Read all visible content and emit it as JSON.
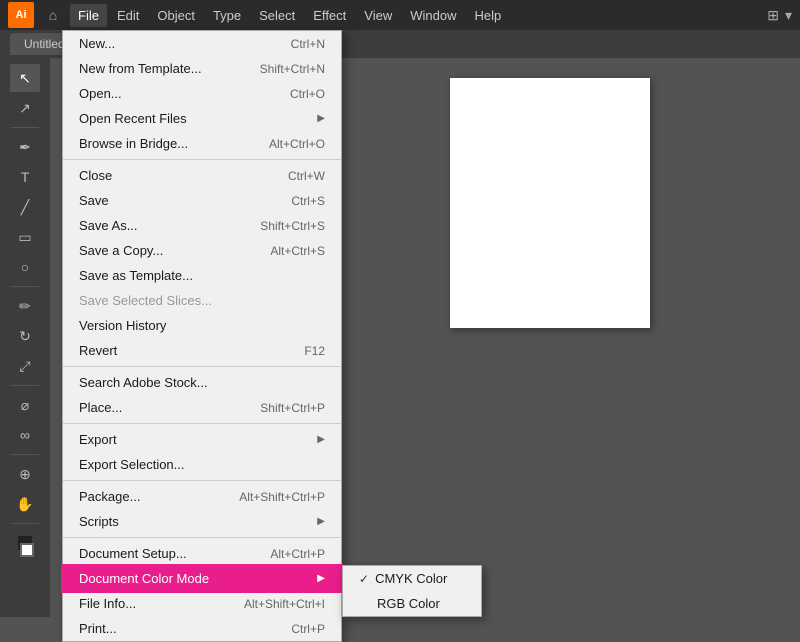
{
  "app": {
    "logo": "Ai",
    "title": "Untitled"
  },
  "menubar": {
    "items": [
      {
        "id": "file",
        "label": "File",
        "active": true
      },
      {
        "id": "edit",
        "label": "Edit"
      },
      {
        "id": "object",
        "label": "Object"
      },
      {
        "id": "type",
        "label": "Type"
      },
      {
        "id": "select",
        "label": "Select"
      },
      {
        "id": "effect",
        "label": "Effect"
      },
      {
        "id": "view",
        "label": "View"
      },
      {
        "id": "window",
        "label": "Window"
      },
      {
        "id": "help",
        "label": "Help"
      }
    ]
  },
  "file_menu": {
    "items": [
      {
        "id": "new",
        "label": "New...",
        "shortcut": "Ctrl+N",
        "disabled": false
      },
      {
        "id": "new-template",
        "label": "New from Template...",
        "shortcut": "Shift+Ctrl+N",
        "disabled": false
      },
      {
        "id": "open",
        "label": "Open...",
        "shortcut": "Ctrl+O",
        "disabled": false
      },
      {
        "id": "open-recent",
        "label": "Open Recent Files",
        "shortcut": "",
        "arrow": true,
        "disabled": false
      },
      {
        "id": "browse-bridge",
        "label": "Browse in Bridge...",
        "shortcut": "Alt+Ctrl+O",
        "disabled": false
      },
      {
        "id": "sep1",
        "type": "separator"
      },
      {
        "id": "close",
        "label": "Close",
        "shortcut": "Ctrl+W",
        "disabled": false
      },
      {
        "id": "save",
        "label": "Save",
        "shortcut": "Ctrl+S",
        "disabled": false
      },
      {
        "id": "save-as",
        "label": "Save As...",
        "shortcut": "Shift+Ctrl+S",
        "disabled": false
      },
      {
        "id": "save-copy",
        "label": "Save a Copy...",
        "shortcut": "Alt+Ctrl+S",
        "disabled": false
      },
      {
        "id": "save-template",
        "label": "Save as Template...",
        "shortcut": "",
        "disabled": false
      },
      {
        "id": "save-selected",
        "label": "Save Selected Slices...",
        "shortcut": "",
        "disabled": true
      },
      {
        "id": "version-history",
        "label": "Version History",
        "shortcut": "",
        "disabled": false
      },
      {
        "id": "revert",
        "label": "Revert",
        "shortcut": "F12",
        "disabled": false
      },
      {
        "id": "sep2",
        "type": "separator"
      },
      {
        "id": "search-stock",
        "label": "Search Adobe Stock...",
        "shortcut": "",
        "disabled": false
      },
      {
        "id": "place",
        "label": "Place...",
        "shortcut": "Shift+Ctrl+P",
        "disabled": false
      },
      {
        "id": "sep3",
        "type": "separator"
      },
      {
        "id": "export",
        "label": "Export",
        "shortcut": "",
        "arrow": true,
        "disabled": false
      },
      {
        "id": "export-selection",
        "label": "Export Selection...",
        "shortcut": "",
        "disabled": false
      },
      {
        "id": "sep4",
        "type": "separator"
      },
      {
        "id": "package",
        "label": "Package...",
        "shortcut": "Alt+Shift+Ctrl+P",
        "disabled": false
      },
      {
        "id": "scripts",
        "label": "Scripts",
        "shortcut": "",
        "arrow": true,
        "disabled": false
      },
      {
        "id": "sep5",
        "type": "separator"
      },
      {
        "id": "document-setup",
        "label": "Document Setup...",
        "shortcut": "Alt+Ctrl+P",
        "disabled": false
      },
      {
        "id": "document-color-mode",
        "label": "Document Color Mode",
        "shortcut": "",
        "arrow": true,
        "disabled": false,
        "highlighted": true
      },
      {
        "id": "file-info",
        "label": "File Info...",
        "shortcut": "Alt+Shift+Ctrl+I",
        "disabled": false
      },
      {
        "id": "print",
        "label": "Print...",
        "shortcut": "",
        "disabled": false
      }
    ],
    "submenu_document_color": {
      "items": [
        {
          "id": "cmyk",
          "label": "CMYK Color",
          "checked": true
        },
        {
          "id": "rgb",
          "label": "RGB Color",
          "checked": false
        }
      ]
    }
  },
  "tools": [
    "cursor",
    "arrow-black",
    "pen",
    "pencil",
    "type",
    "line",
    "rect",
    "ellipse",
    "brush",
    "eraser",
    "rotate",
    "scale",
    "eyedropper",
    "zoom",
    "hand",
    "color-fill"
  ]
}
